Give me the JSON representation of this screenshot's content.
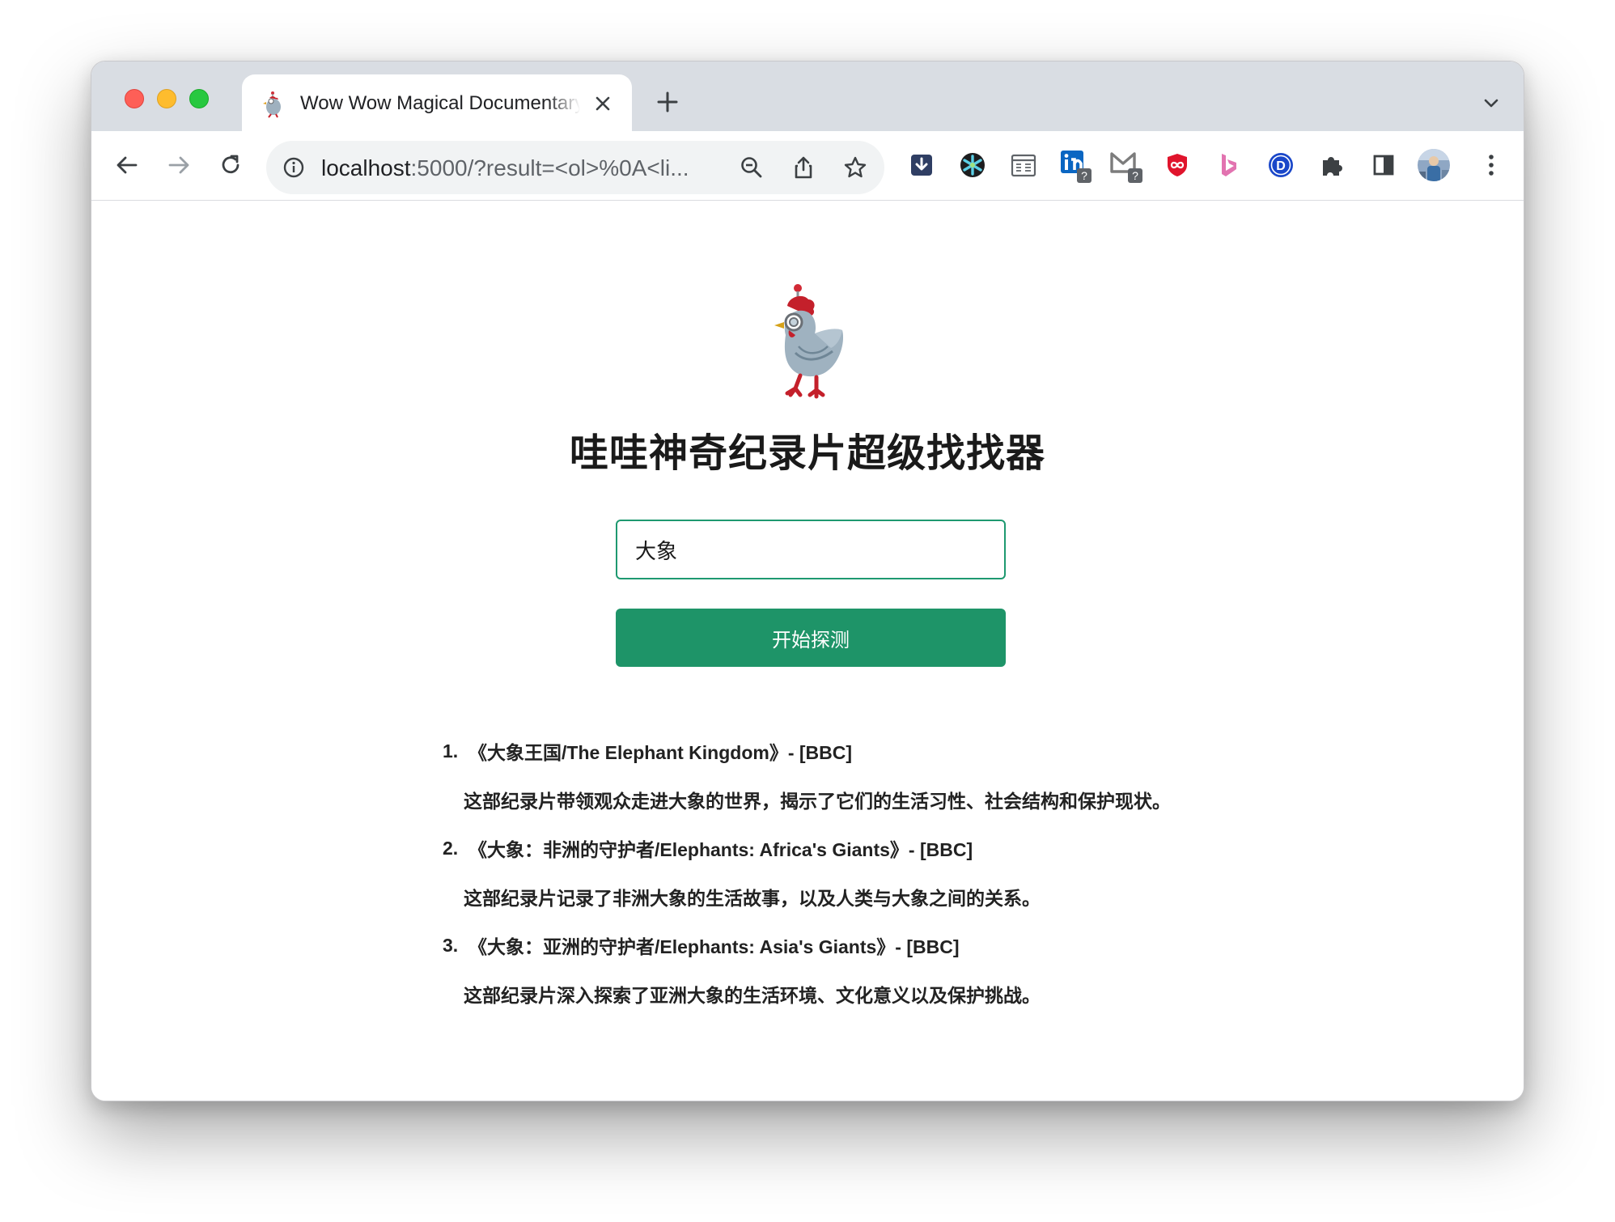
{
  "browser": {
    "tab": {
      "title": "Wow Wow Magical Documentary Finder",
      "favicon": "robot-chicken-icon"
    },
    "address_bar": {
      "host": "localhost",
      "rest": ":5000/?result=<ol>%0A<li..."
    },
    "extensions": [
      "downloader-icon",
      "asterisk-ext-icon",
      "calendar-ext-icon",
      "linkedin-ext-icon",
      "gmail-ext-icon",
      "infinity-ext-icon",
      "bing-icon",
      "d-ext-icon",
      "puzzle-icon",
      "sidepanel-icon",
      "profile-avatar",
      "more-menu-icon"
    ],
    "badge_text": "?"
  },
  "page": {
    "title": "哇哇神奇纪录片超级找找器",
    "search": {
      "value": "大象",
      "placeholder": ""
    },
    "submit_label": "开始探测",
    "accent_color": "#1e9468"
  },
  "results": [
    {
      "num": "1.",
      "heading": "《大象王国/The Elephant Kingdom》- [BBC]",
      "desc": "这部纪录片带领观众走进大象的世界，揭示了它们的生活习性、社会结构和保护现状。"
    },
    {
      "num": "2.",
      "heading": "《大象：非洲的守护者/Elephants: Africa's Giants》- [BBC]",
      "desc": "这部纪录片记录了非洲大象的生活故事，以及人类与大象之间的关系。"
    },
    {
      "num": "3.",
      "heading": "《大象：亚洲的守护者/Elephants: Asia's Giants》- [BBC]",
      "desc": "这部纪录片深入探索了亚洲大象的生活环境、文化意义以及保护挑战。"
    }
  ]
}
